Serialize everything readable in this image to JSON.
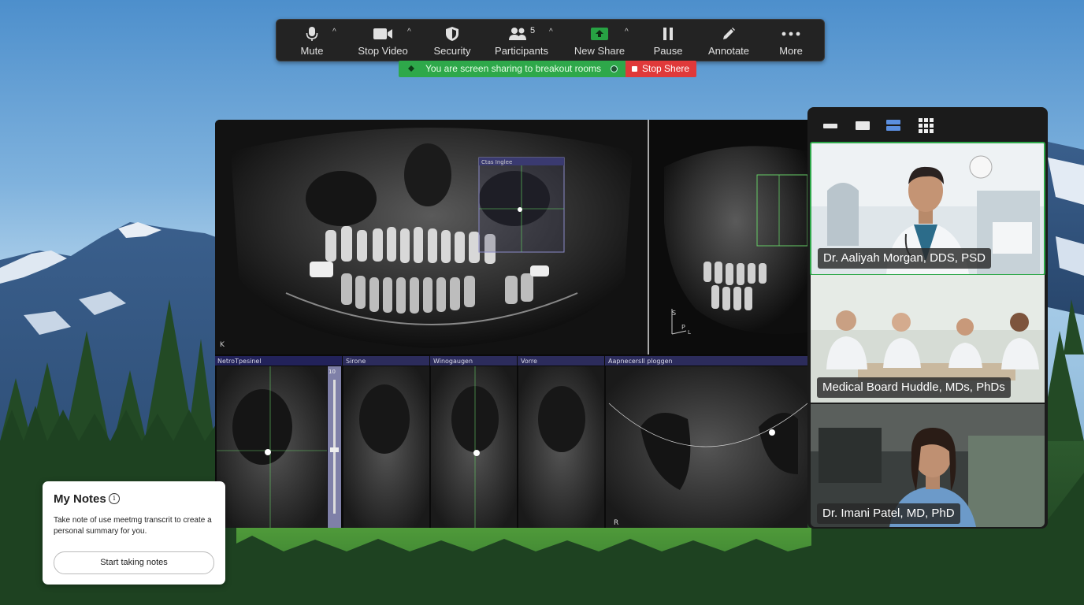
{
  "toolbar": {
    "items": [
      {
        "label": "Mute",
        "icon": "microphone-icon"
      },
      {
        "label": "Stop Video",
        "icon": "video-camera-icon"
      },
      {
        "label": "Security",
        "icon": "shield-icon"
      },
      {
        "label": "Participants",
        "icon": "participants-icon",
        "count": "5"
      },
      {
        "label": "New Share",
        "icon": "share-screen-icon"
      },
      {
        "label": "Pause",
        "icon": "pause-icon"
      },
      {
        "label": "Annotate",
        "icon": "pencil-icon"
      },
      {
        "label": "More",
        "icon": "more-dots-icon"
      }
    ],
    "accent": "#2ea84a"
  },
  "banner": {
    "message": "You are screen sharing to breakout rooms",
    "stop_label": "Stop Shere",
    "green": "#2ea84a",
    "red": "#e0393a"
  },
  "shared_screen": {
    "roi_label": "Ctas Inglee",
    "pane_labels": [
      "NetroTpesinel",
      "Sirone",
      "Winogaugen",
      "Vorre",
      "Aapnecersll ploggen"
    ],
    "orientation_labels": [
      "K",
      "R",
      "S",
      "P",
      "L"
    ],
    "scale_label": "10"
  },
  "video_panel": {
    "layout_buttons": [
      "speaker-view-icon",
      "gallery-small-icon",
      "stacked-view-icon",
      "grid-view-icon"
    ],
    "participants": [
      {
        "name": "Dr. Aaliyah Morgan, DDS, PSD",
        "active": true
      },
      {
        "name": "Medical Board Huddle, MDs, PhDs",
        "active": false
      },
      {
        "name": "Dr. Imani Patel, MD, PhD",
        "active": false
      }
    ]
  },
  "notes": {
    "title": "My Notes",
    "body": "Take note of use meetmg transcrit to create a personal summary for you.",
    "button": "Start taking notes"
  }
}
